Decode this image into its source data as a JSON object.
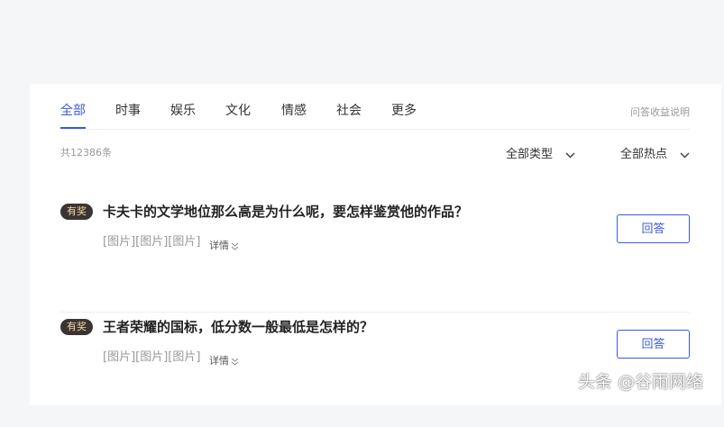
{
  "tabs": [
    {
      "label": "全部",
      "active": true
    },
    {
      "label": "时事",
      "active": false
    },
    {
      "label": "娱乐",
      "active": false
    },
    {
      "label": "文化",
      "active": false
    },
    {
      "label": "情感",
      "active": false
    },
    {
      "label": "社会",
      "active": false
    },
    {
      "label": "更多",
      "active": false
    }
  ],
  "help_link": "问答收益说明",
  "count_text": "共12386条",
  "filters": {
    "type": "全部类型",
    "hot": "全部热点"
  },
  "questions": [
    {
      "badge": "有奖",
      "title": "卡夫卡的文学地位那么高是为什么呢，要怎样鉴赏他的作品？",
      "images": "[图片][图片][图片]",
      "detail": "详情",
      "answer": "回答"
    },
    {
      "badge": "有奖",
      "title": "王者荣耀的国标，低分数一般最低是怎样的？",
      "images": "[图片][图片][图片]",
      "detail": "详情",
      "answer": "回答"
    }
  ],
  "watermark": "头条 @谷雨网络",
  "colors": {
    "accent": "#3b5bdb",
    "badge_bg": "#3a3532",
    "badge_text": "#f3d8a6"
  }
}
